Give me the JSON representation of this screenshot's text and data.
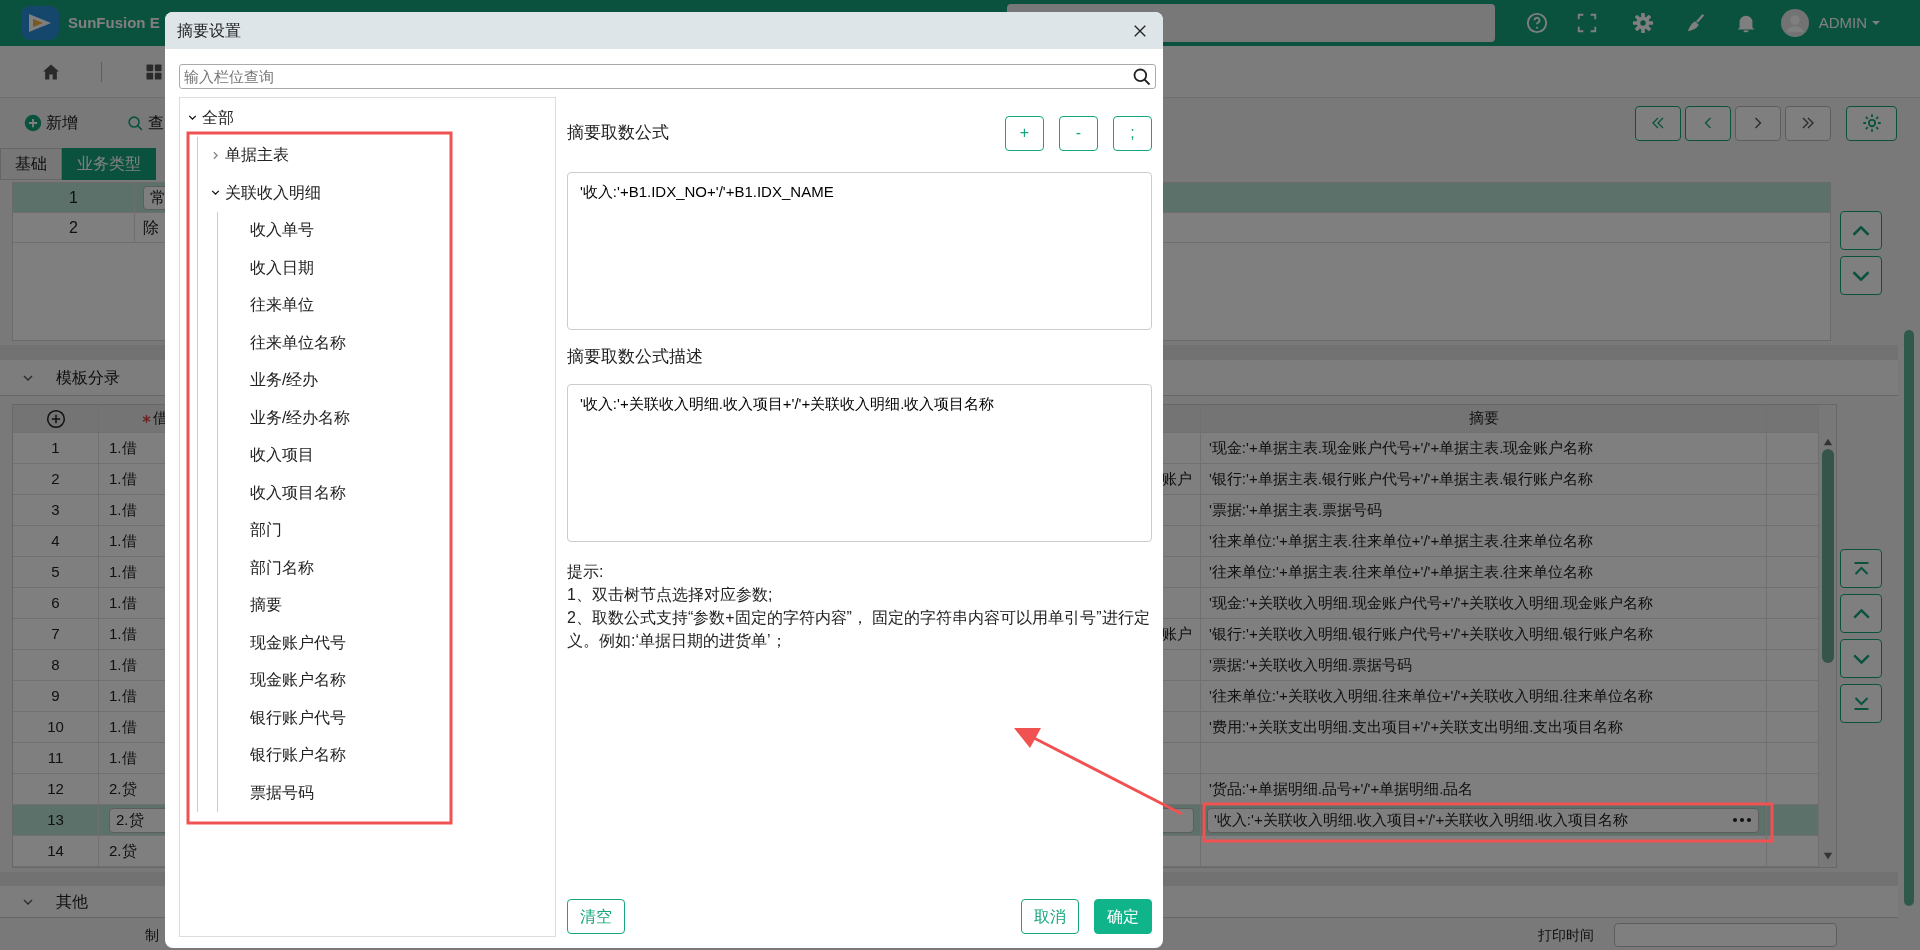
{
  "header": {
    "brand": "SunFusion E",
    "user": "ADMIN"
  },
  "toolbar": {
    "add": "新增",
    "query": "查"
  },
  "tabs": [
    {
      "label": "基础",
      "selected": false
    },
    {
      "label": "业务类型",
      "selected": true
    }
  ],
  "type_table": {
    "rows": [
      {
        "no": "1",
        "name": "常",
        "selected": true
      },
      {
        "no": "2",
        "name": "除",
        "selected": false
      }
    ]
  },
  "entry_section": {
    "title": "模板分录",
    "expanded": true
  },
  "entry_table": {
    "column_2": {
      "label": "借",
      "required": true
    },
    "summary_column": "摘要",
    "rows": [
      {
        "no": "1",
        "column_2": "1.借",
        "summary": "'现金:'+单据主表.现金账户代号+'/'+单据主表.现金账户名称",
        "selected": false
      },
      {
        "no": "2",
        "column_2": "1.借",
        "column_3": "账户",
        "summary": "'银行:'+单据主表.银行账户代号+'/'+单据主表.银行账户名称",
        "selected": false
      },
      {
        "no": "3",
        "column_2": "1.借",
        "summary": "'票据:'+单据主表.票据号码",
        "selected": false
      },
      {
        "no": "4",
        "column_2": "1.借",
        "summary": "'往来单位:'+单据主表.往来单位+'/'+单据主表.往来单位名称",
        "selected": false
      },
      {
        "no": "5",
        "column_2": "1.借",
        "summary": "'往来单位:'+单据主表.往来单位+'/'+单据主表.往来单位名称",
        "selected": false
      },
      {
        "no": "6",
        "column_2": "1.借",
        "summary": "'现金:'+关联收入明细.现金账户代号+'/'+关联收入明细.现金账户名称",
        "selected": false
      },
      {
        "no": "7",
        "column_2": "1.借",
        "column_3": "账户",
        "summary": "'银行:'+关联收入明细.银行账户代号+'/'+关联收入明细.银行账户名称",
        "selected": false
      },
      {
        "no": "8",
        "column_2": "1.借",
        "summary": "'票据:'+关联收入明细.票据号码",
        "selected": false
      },
      {
        "no": "9",
        "column_2": "1.借",
        "summary": "'往来单位:'+关联收入明细.往来单位+'/'+关联收入明细.往来单位名称",
        "selected": false
      },
      {
        "no": "10",
        "column_2": "1.借",
        "summary": "'费用:'+关联支出明细.支出项目+'/'+关联支出明细.支出项目名称",
        "selected": false
      },
      {
        "no": "11",
        "column_2": "1.借",
        "selected": false
      },
      {
        "no": "12",
        "column_2": "2.贷",
        "summary": "'货品:'+单据明细.品号+'/'+单据明细.品名",
        "selected": false
      },
      {
        "no": "13",
        "column_2": "2.贷",
        "summary": "'收入:'+关联收入明细.收入项目+'/'+关联收入明细.收入项目名称",
        "selected": true
      },
      {
        "no": "14",
        "column_2": "2.贷",
        "selected": false
      }
    ]
  },
  "other_section": {
    "title": "其他",
    "expanded": true,
    "fields": [
      {
        "label": "制"
      },
      {
        "label": "打印时间"
      }
    ]
  },
  "dialog": {
    "title": "摘要设置",
    "search": {
      "placeholder": "输入栏位查询"
    },
    "tree": [
      {
        "label": "全部",
        "expanded": true,
        "children": [
          {
            "label": "单据主表",
            "expanded": false
          },
          {
            "label": "关联收入明细",
            "expanded": true,
            "children": [
              {
                "label": "收入单号"
              },
              {
                "label": "收入日期"
              },
              {
                "label": "往来单位"
              },
              {
                "label": "往来单位名称"
              },
              {
                "label": "业务/经办"
              },
              {
                "label": "业务/经办名称"
              },
              {
                "label": "收入项目"
              },
              {
                "label": "收入项目名称"
              },
              {
                "label": "部门"
              },
              {
                "label": "部门名称"
              },
              {
                "label": "摘要"
              },
              {
                "label": "现金账户代号"
              },
              {
                "label": "现金账户名称"
              },
              {
                "label": "银行账户代号"
              },
              {
                "label": "银行账户名称"
              },
              {
                "label": "票据号码"
              }
            ]
          }
        ]
      }
    ],
    "formula": {
      "label": "摘要取数公式",
      "value": "'收入:'+B1.IDX_NO+'/'+B1.IDX_NAME"
    },
    "operators": [
      "+",
      "-",
      ";"
    ],
    "description": {
      "label": "摘要取数公式描述",
      "value": "'收入:'+关联收入明细.收入项目+'/'+关联收入明细.收入项目名称"
    },
    "hints": [
      "提示:",
      "1、双击树节点选择对应参数;",
      "2、取数公式支持“参数+固定的字符内容”， 固定的字符串内容可以用单引号”进行定义。例如:‘单据日期的进货单’；"
    ],
    "buttons": {
      "clear": "清空",
      "cancel": "取消",
      "confirm": "确定"
    }
  }
}
